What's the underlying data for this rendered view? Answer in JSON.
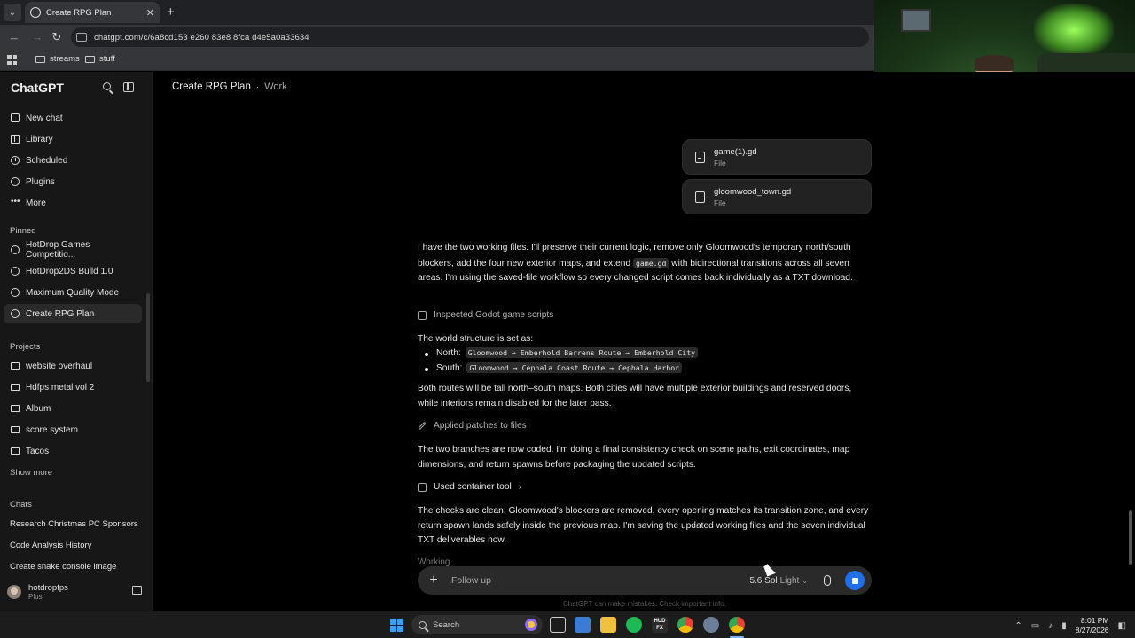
{
  "browser": {
    "tab_title": "Create RPG Plan",
    "url": "chatgpt.com/c/6a8cd153 e260 83e8 8fca d4e5a0a33634",
    "bookmarks": [
      "streams",
      "stuff"
    ]
  },
  "sidebar": {
    "brand": "ChatGPT",
    "nav": [
      "New chat",
      "Library",
      "Scheduled",
      "Plugins",
      "More"
    ],
    "pinned_heading": "Pinned",
    "pinned": [
      "HotDrop Games Competitio...",
      "HotDrop2DS Build 1.0",
      "Maximum Quality Mode",
      "Create RPG Plan"
    ],
    "projects_heading": "Projects",
    "projects": [
      "website overhaul",
      "Hdfps metal vol 2",
      "Album",
      "score system",
      "Tacos"
    ],
    "show_more": "Show more",
    "chats_heading": "Chats",
    "chats": [
      "Research Christmas PC Sponsors",
      "Code Analysis History",
      "Create snake console image"
    ],
    "user": {
      "name": "hotdropfps",
      "plan": "Plus"
    }
  },
  "header": {
    "title": "Create RPG Plan",
    "separator": "·",
    "project": "Work"
  },
  "files": [
    {
      "name": "game(1).gd",
      "type": "File"
    },
    {
      "name": "gloomwood_town.gd",
      "type": "File"
    }
  ],
  "messages": {
    "intro_before": "I have the two working files. I'll preserve their current logic, remove only Gloomwood's temporary north/south blockers, add the four new exterior maps, and extend ",
    "intro_code": "game.gd",
    "intro_after": " with bidirectional transitions across all seven areas. I'm using the saved-file workflow so every changed script comes back individually as a TXT download.",
    "step1": "Inspected Godot game scripts",
    "world_heading": "The world structure is set as:",
    "north_label": "North:",
    "north_route": "Gloomwood → Emberhold Barrens Route → Emberhold City",
    "south_label": "South:",
    "south_route": "Gloomwood → Cephala Coast Route → Cephala Harbor",
    "routes_para": "Both routes will be tall north–south maps. Both cities will have multiple exterior buildings and reserved doors, while interiors remain disabled for the later pass.",
    "step2": "Applied patches to files",
    "branches_para": "The two branches are now coded. I'm doing a final consistency check on scene paths, exit coordinates, map dimensions, and return spawns before packaging the updated scripts.",
    "step3": "Used container tool",
    "checks_para": "The checks are clean: Gloomwood's blockers are removed, every opening matches its transition zone, and every return spawn lands safely inside the previous map. I'm saving the updated working files and the seven individual TXT deliverables now.",
    "working": "Working"
  },
  "composer": {
    "placeholder": "Follow up",
    "model": "5.6 Sol",
    "mode": "Light",
    "disclaimer": "ChatGPT can make mistakes. Check important info."
  },
  "taskbar": {
    "search_label": "Search",
    "hud_label": "HUD FX",
    "time": "8:01 PM",
    "date": "8/27/2026"
  }
}
